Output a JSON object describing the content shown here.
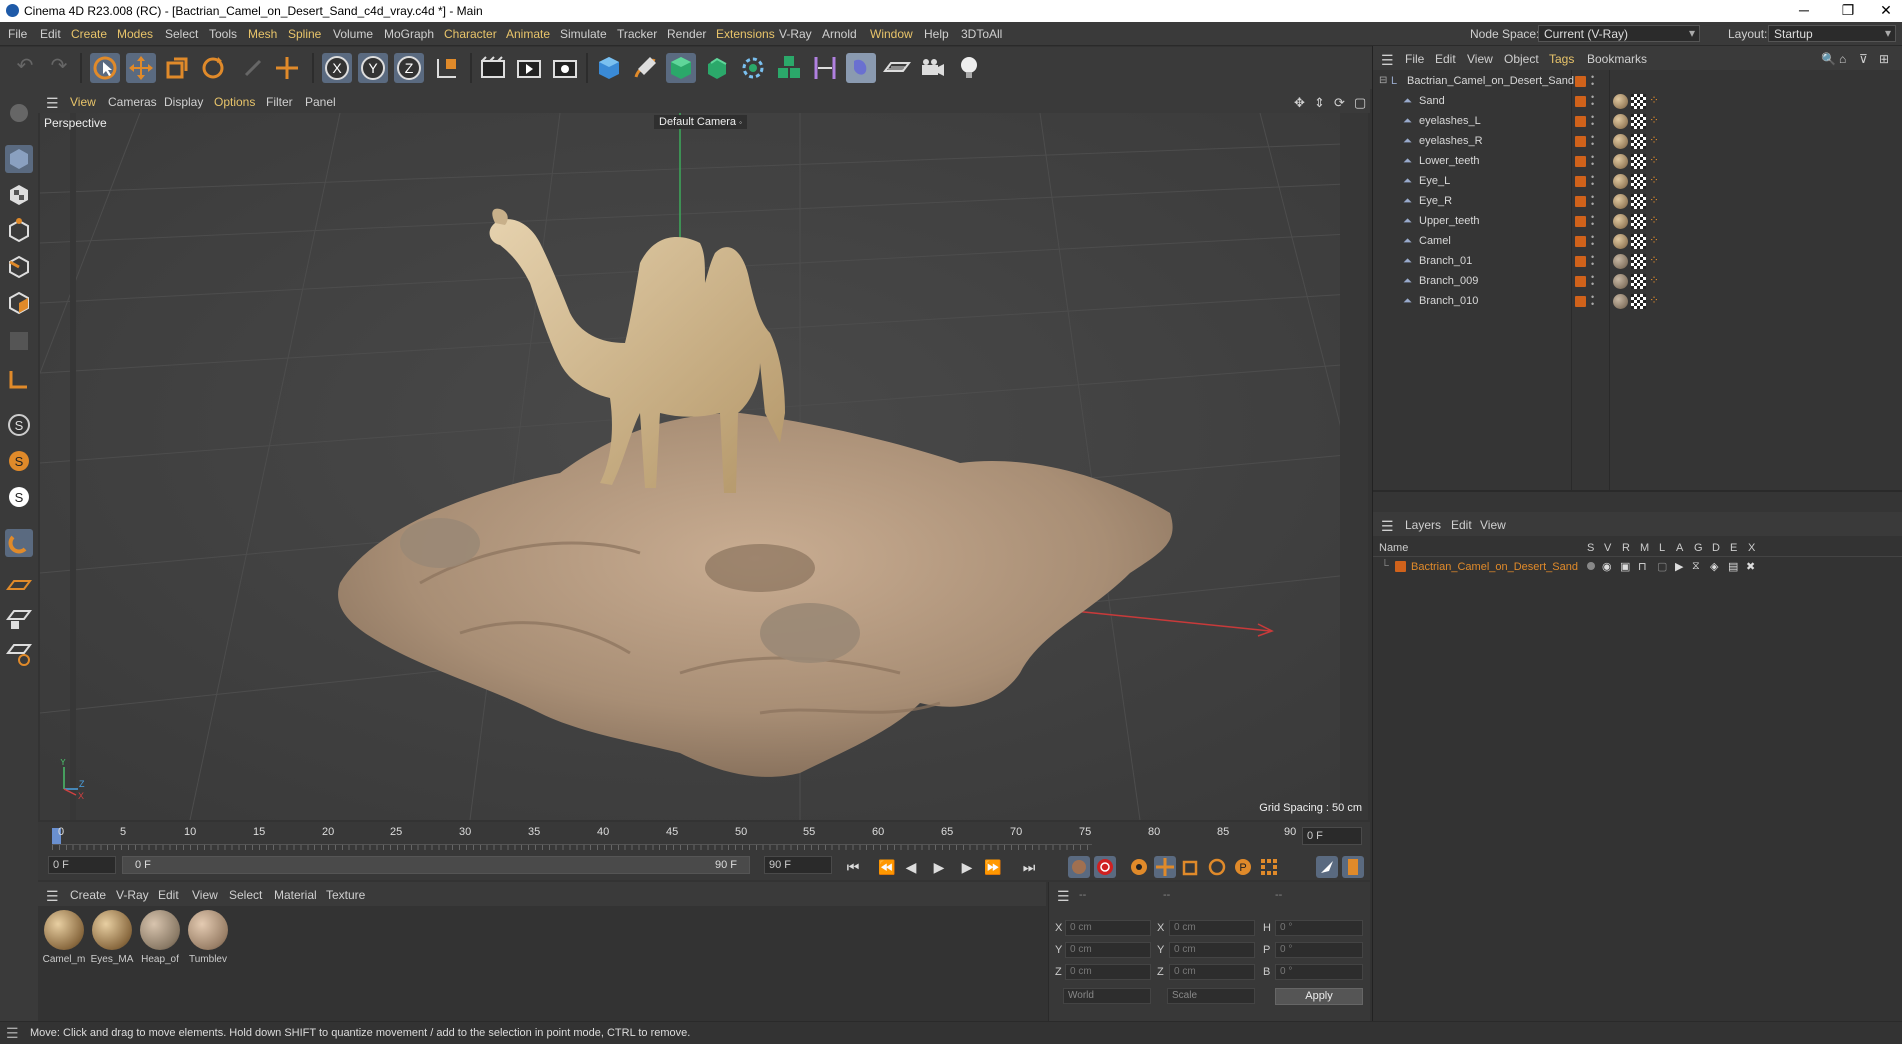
{
  "window": {
    "title": "Cinema 4D R23.008 (RC) - [Bactrian_Camel_on_Desert_Sand_c4d_vray.c4d *] - Main",
    "min": "─",
    "max": "❐",
    "close": "✕"
  },
  "menubar": {
    "items": [
      "File",
      "Edit",
      "Create",
      "Modes",
      "Select",
      "Tools",
      "Mesh",
      "Spline",
      "Volume",
      "MoGraph",
      "Character",
      "Animate",
      "Simulate",
      "Tracker",
      "Render",
      "Extensions",
      "V-Ray",
      "Arnold",
      "Window",
      "Help",
      "3DToAll"
    ],
    "node_space_label": "Node Space:",
    "node_space_value": "Current (V-Ray)",
    "layout_label": "Layout:",
    "layout_value": "Startup"
  },
  "toolbar": {
    "x": "X",
    "y": "Y",
    "z": "Z"
  },
  "viewport": {
    "menu": [
      "View",
      "Cameras",
      "Display",
      "Options",
      "Filter",
      "Panel"
    ],
    "label": "Perspective",
    "camera": "Default Camera",
    "grid_spacing": "Grid Spacing : 50 cm",
    "axis_y": "Y",
    "axis_z": "Z",
    "axis_x": "X"
  },
  "timeline": {
    "ticks": [
      "0",
      "5",
      "10",
      "15",
      "20",
      "25",
      "30",
      "35",
      "40",
      "45",
      "50",
      "55",
      "60",
      "65",
      "70",
      "75",
      "80",
      "85",
      "90"
    ],
    "current_frame": "0 F",
    "start": "0 F",
    "range_start": "0 F",
    "range_end": "90 F",
    "end": "90 F"
  },
  "materials": {
    "menu": [
      "Create",
      "V-Ray",
      "Edit",
      "View",
      "Select",
      "Material",
      "Texture"
    ],
    "items": [
      {
        "name": "Camel_m",
        "color": "#8a6a40"
      },
      {
        "name": "Eyes_MA",
        "color": "#8a6a40"
      },
      {
        "name": "Heap_of",
        "color": "#8a7a66"
      },
      {
        "name": "Tumblev",
        "color": "#9a8068"
      }
    ]
  },
  "coords": {
    "header": [
      "--",
      "--",
      "--"
    ],
    "rows": [
      {
        "l1": "X",
        "v1": "0 cm",
        "l2": "X",
        "v2": "0 cm",
        "l3": "H",
        "v3": "0 °"
      },
      {
        "l1": "Y",
        "v1": "0 cm",
        "l2": "Y",
        "v2": "0 cm",
        "l3": "P",
        "v3": "0 °"
      },
      {
        "l1": "Z",
        "v1": "0 cm",
        "l2": "Z",
        "v2": "0 cm",
        "l3": "B",
        "v3": "0 °"
      }
    ],
    "space": "World",
    "mode": "Scale",
    "apply": "Apply"
  },
  "object_manager": {
    "menu": [
      "File",
      "Edit",
      "View",
      "Object",
      "Tags",
      "Bookmarks"
    ],
    "root": "Bactrian_Camel_on_Desert_Sand",
    "objects": [
      "Sand",
      "eyelashes_L",
      "eyelashes_R",
      "Lower_teeth",
      "Eye_L",
      "Eye_R",
      "Upper_teeth",
      "Camel",
      "Branch_01",
      "Branch_009",
      "Branch_010"
    ]
  },
  "layers": {
    "menu": [
      "Layers",
      "Edit",
      "View"
    ],
    "name_col": "Name",
    "cols": [
      "S",
      "V",
      "R",
      "M",
      "L",
      "A",
      "G",
      "D",
      "E",
      "X"
    ],
    "layer_name": "Bactrian_Camel_on_Desert_Sand"
  },
  "status": "Move: Click and drag to move elements. Hold down SHIFT to quantize movement / add to the selection in point mode, CTRL to remove."
}
